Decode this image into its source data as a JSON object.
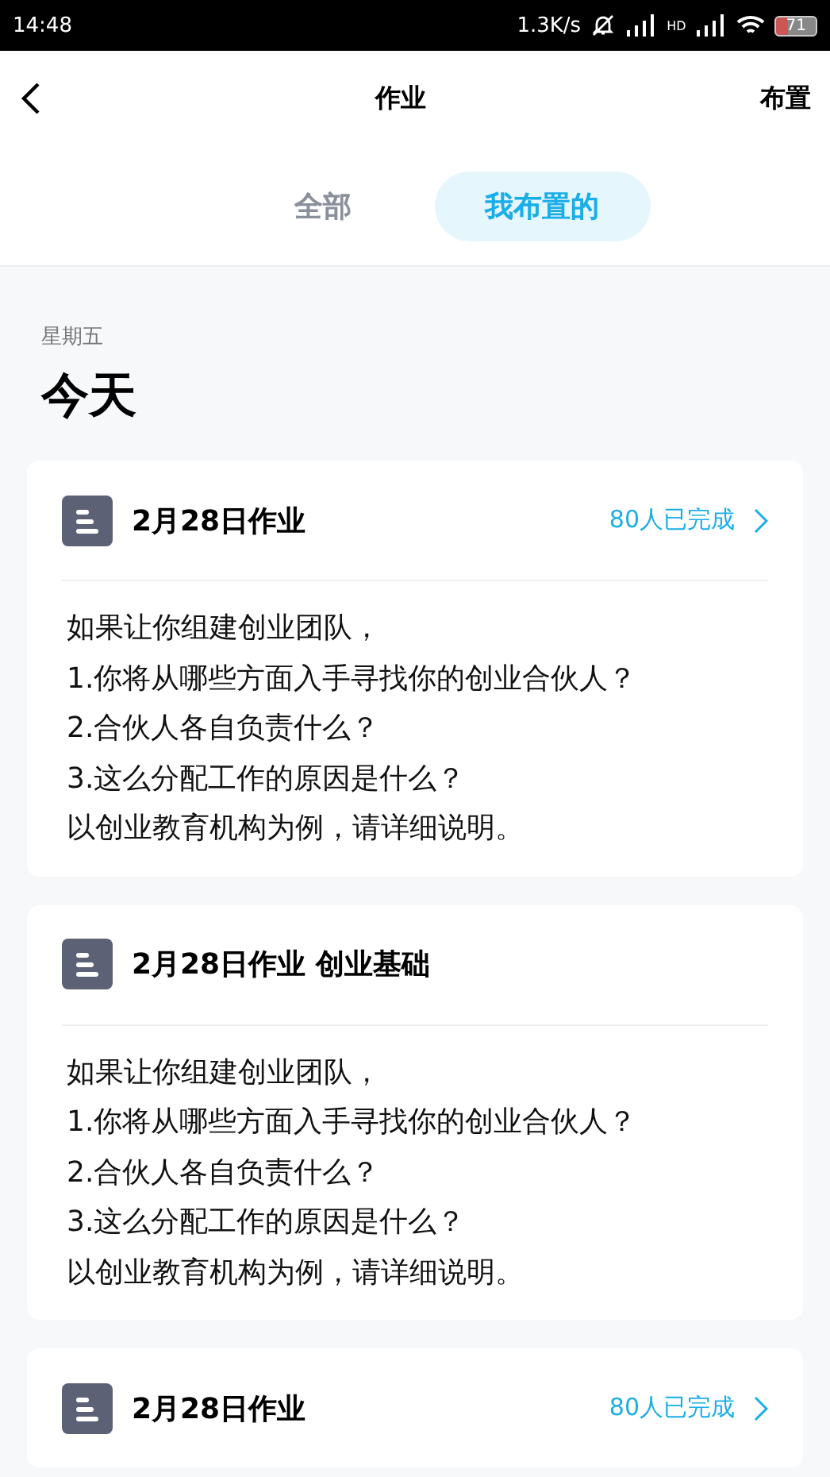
{
  "status_bar": {
    "time": "14:48",
    "speed": "1.3K/s",
    "network": "HD",
    "battery": "71"
  },
  "nav": {
    "title": "作业",
    "action": "布置"
  },
  "tabs": [
    {
      "label": "全部",
      "selected": false
    },
    {
      "label": "我布置的",
      "selected": true
    }
  ],
  "section": {
    "weekday": "星期五",
    "heading": "今天"
  },
  "cards": [
    {
      "title": "2月28日作业",
      "completed": "80人已完成",
      "lines": [
        "如果让你组建创业团队，",
        "1.你将从哪些方面入手寻找你的创业合伙人？",
        "2.合伙人各自负责什么？",
        "3.这么分配工作的原因是什么？",
        "以创业教育机构为例，请详细说明。"
      ]
    },
    {
      "title": "2月28日作业 创业基础",
      "lines": [
        "如果让你组建创业团队，",
        "1.你将从哪些方面入手寻找你的创业合伙人？",
        "2.合伙人各自负责什么？",
        "3.这么分配工作的原因是什么？",
        "以创业教育机构为例，请详细说明。"
      ]
    },
    {
      "title": "2月28日作业",
      "completed": "80人已完成"
    }
  ]
}
